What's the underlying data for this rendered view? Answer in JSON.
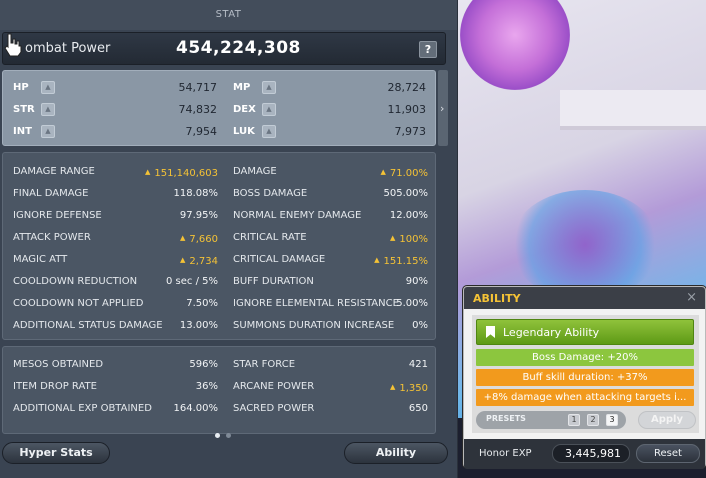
{
  "window": {
    "title": "STAT"
  },
  "combat_power": {
    "label": "ombat Power",
    "value": "454,224,308",
    "help": "?"
  },
  "base_stats": [
    {
      "name": "HP",
      "value": "54,717"
    },
    {
      "name": "MP",
      "value": "28,724"
    },
    {
      "name": "STR",
      "value": "74,832"
    },
    {
      "name": "DEX",
      "value": "11,903"
    },
    {
      "name": "INT",
      "value": "7,954"
    },
    {
      "name": "LUK",
      "value": "7,973"
    }
  ],
  "detail_stats": [
    {
      "label": "DAMAGE RANGE",
      "value": "151,140,603",
      "up": true
    },
    {
      "label": "DAMAGE",
      "value": "71.00%",
      "up": true
    },
    {
      "label": "FINAL DAMAGE",
      "value": "118.08%",
      "up": false
    },
    {
      "label": "BOSS DAMAGE",
      "value": "505.00%",
      "up": false
    },
    {
      "label": "IGNORE DEFENSE",
      "value": "97.95%",
      "up": false
    },
    {
      "label": "NORMAL ENEMY DAMAGE",
      "value": "12.00%",
      "up": false
    },
    {
      "label": "ATTACK POWER",
      "value": "7,660",
      "up": true
    },
    {
      "label": "CRITICAL RATE",
      "value": "100%",
      "up": true
    },
    {
      "label": "MAGIC ATT",
      "value": "2,734",
      "up": true
    },
    {
      "label": "CRITICAL DAMAGE",
      "value": "151.15%",
      "up": true
    },
    {
      "label": "COOLDOWN REDUCTION",
      "value": "0 sec / 5%",
      "up": false
    },
    {
      "label": "BUFF DURATION",
      "value": "90%",
      "up": false
    },
    {
      "label": "COOLDOWN NOT APPLIED",
      "value": "7.50%",
      "up": false
    },
    {
      "label": "IGNORE ELEMENTAL RESISTANCE",
      "value": "5.00%",
      "up": false
    },
    {
      "label": "ADDITIONAL STATUS DAMAGE",
      "value": "13.00%",
      "up": false
    },
    {
      "label": "SUMMONS DURATION INCREASE",
      "value": "0%",
      "up": false
    }
  ],
  "misc_stats": [
    {
      "label": "MESOS OBTAINED",
      "value": "596%",
      "up": false
    },
    {
      "label": "STAR FORCE",
      "value": "421",
      "up": false
    },
    {
      "label": "ITEM DROP RATE",
      "value": "36%",
      "up": false
    },
    {
      "label": "ARCANE POWER",
      "value": "1,350",
      "up": true
    },
    {
      "label": "ADDITIONAL EXP OBTAINED",
      "value": "164.00%",
      "up": false
    },
    {
      "label": "SACRED POWER",
      "value": "650",
      "up": false
    }
  ],
  "buttons": {
    "hyper_stats": "Hyper Stats",
    "ability": "Ability"
  },
  "ability_window": {
    "title": "ABILITY",
    "close": "×",
    "rank": "Legendary Ability",
    "lines": [
      "Boss Damage: +20%",
      "Buff skill duration: +37%",
      "+8% damage when attacking targets i..."
    ],
    "presets_label": "PRESETS",
    "presets": [
      "1",
      "2",
      "3"
    ],
    "apply": "Apply",
    "honor_label": "Honor EXP",
    "honor_value": "3,445,981",
    "reset": "Reset"
  },
  "colors": {
    "gold": "#f4c236",
    "rare_green": "#8cc63e",
    "unique_orange": "#f29a1d"
  },
  "icons": {
    "help": "help-icon",
    "up": "plus-icon",
    "close": "close-icon",
    "bookmark": "bookmark-icon",
    "cursor": "hand-cursor-icon"
  }
}
